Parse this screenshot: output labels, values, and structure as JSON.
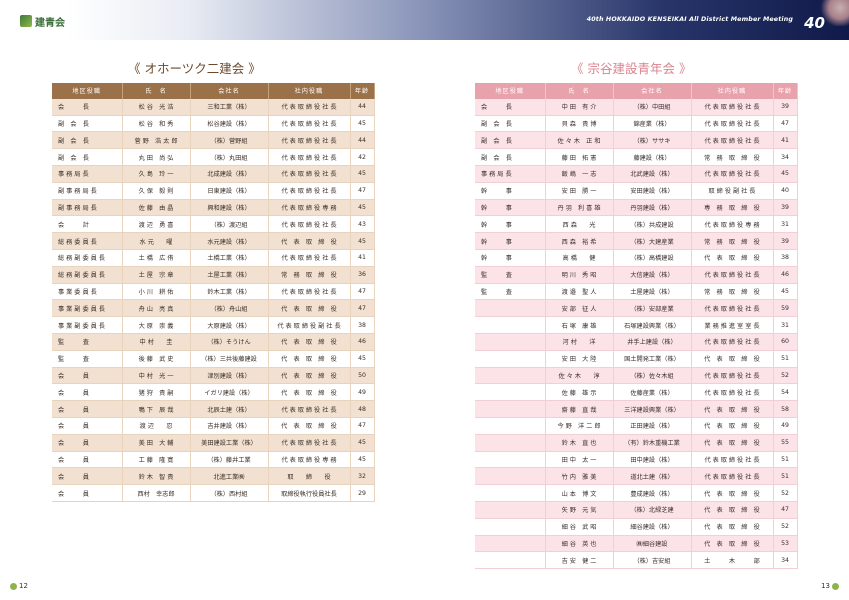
{
  "header": {
    "logo_text": "建青会",
    "meeting_title": "40th HOKKAIDO KENSEIKAI All District Member Meeting",
    "badge": "40"
  },
  "columns": [
    "地区役職",
    "氏　名",
    "会社名",
    "社内役職",
    "年齢"
  ],
  "left": {
    "title": "《 オホーツク二建会 》",
    "rows": [
      [
        "会　　　長",
        "松 谷　光 浩",
        "三和工業（株）",
        "代 表 取 締 役 社 長",
        "44"
      ],
      [
        "副　会　長",
        "松 谷　和 秀",
        "松谷建設（株）",
        "代 表 取 締 役 社 長",
        "45"
      ],
      [
        "副　会　長",
        "菅 野　浩 太 郎",
        "（株）菅野組",
        "代 表 取 締 役 社 長",
        "44"
      ],
      [
        "副　会　長",
        "丸 田　尚 弘",
        "（株）丸田組",
        "代 表 取 締 役 社 長",
        "42"
      ],
      [
        "事 務 局 長",
        "久 島　玲 一",
        "北成建設（株）",
        "代 表 取 締 役 社 長",
        "45"
      ],
      [
        "副 事 務 局 長",
        "久 保　毅 則",
        "日東建設（株）",
        "代 表 取 締 役 社 長",
        "47"
      ],
      [
        "副 事 務 局 長",
        "佐 藤　由 晶",
        "興和建設（株）",
        "代 表 取 締 役 専 務",
        "45"
      ],
      [
        "会　　　計",
        "渡 辺　勇 喜",
        "（株）渡辺組",
        "代 表 取 締 役 社 長",
        "43"
      ],
      [
        "総 務 委 員 長",
        "水 元　　曜",
        "水元建設（株）",
        "代　表　取　締　役",
        "45"
      ],
      [
        "総 務 副 委 員 長",
        "土 橋　広 侑",
        "土橋工業（株）",
        "代 表 取 締 役 社 長",
        "41"
      ],
      [
        "総 務 副 委 員 長",
        "土 屋　宗 章",
        "土屋工業（株）",
        "常　務　取　締　役",
        "36"
      ],
      [
        "事 業 委 員 長",
        "小 川　耕 佑",
        "鈴木工業（株）",
        "代 表 取 締 役 社 長",
        "47"
      ],
      [
        "事 業 副 委 員 長",
        "舟 山　亮 真",
        "（株）舟山組",
        "代　表　取　締　役",
        "47"
      ],
      [
        "事 業 副 委 員 長",
        "大 原　崇 義",
        "大原建設（株）",
        "代 表 取 締 役 副 社 長",
        "38"
      ],
      [
        "監　　　査",
        "中 村　　圭",
        "（株）そうけん",
        "代　表　取　締　役",
        "46"
      ],
      [
        "監　　　査",
        "後 藤　武 史",
        "（株）三共後藤建設",
        "代　表　取　締　役",
        "45"
      ],
      [
        "会　　　員",
        "中 村　光 一",
        "津別建設（株）",
        "代　表　取　締　役",
        "50"
      ],
      [
        "会　　　員",
        "猪 狩　貴 嗣",
        "イガリ建設（株）",
        "代　表　取　締　役",
        "49"
      ],
      [
        "会　　　員",
        "鴨 下　辰 哉",
        "北辰土建（株）",
        "代 表 取 締 役 社 長",
        "48"
      ],
      [
        "会　　　員",
        "渡 辺　　忍",
        "吉井建設（株）",
        "代　表　取　締　役",
        "47"
      ],
      [
        "会　　　員",
        "美 田　大 輔",
        "美田建設工業（株）",
        "代 表 取 締 役 社 長",
        "45"
      ],
      [
        "会　　　員",
        "工 藤　隆 寛",
        "（株）藤井工業",
        "代 表 取 締 役 専 務",
        "45"
      ],
      [
        "会　　　員",
        "鈴 木　智 貴",
        "北進工業㈱",
        "取　　締　　役",
        "32"
      ],
      [
        "会　　　員",
        "西村　幸志郎",
        "（株）西村組",
        "取締役執行役員社長",
        "29"
      ]
    ]
  },
  "right": {
    "title": "《 宗谷建設青年会 》",
    "rows": [
      [
        "会　　　長",
        "中 田　有 介",
        "（株）中田組",
        "代 表 取 締 役 社 長",
        "39"
      ],
      [
        "副　会　長",
        "貝 森　貴 博",
        "錦産業（株）",
        "代 表 取 締 役 社 長",
        "47"
      ],
      [
        "副　会　長",
        "佐 々 木　正 和",
        "（株）ササキ",
        "代 表 取 締 役 社 長",
        "41"
      ],
      [
        "副　会　長",
        "藤 田　拓 憲",
        "藤建設（株）",
        "常　務　取　締　役",
        "34"
      ],
      [
        "事 務 局 長",
        "飯 嶋　一 志",
        "北武建設（株）",
        "代 表 取 締 役 社 長",
        "45"
      ],
      [
        "幹　　　事",
        "安 田　勝 一",
        "安田建設（株）",
        "取 締 役 副 社 長",
        "40"
      ],
      [
        "幹　　　事",
        "丹 羽　利 喜 雄",
        "丹羽建設（株）",
        "専　務　取　締　役",
        "39"
      ],
      [
        "幹　　　事",
        "西 森　　光",
        "（株）共成建設",
        "代 表 取 締 役 専 務",
        "31"
      ],
      [
        "幹　　　事",
        "西 森　裕 希",
        "（株）大建産業",
        "常　務　取　締　役",
        "39"
      ],
      [
        "幹　　　事",
        "高 橋　　健",
        "（株）高橋建設",
        "代　表　取　締　役",
        "38"
      ],
      [
        "監　　　査",
        "明 川　秀 昭",
        "大信建設（株）",
        "代 表 取 締 役 社 長",
        "46"
      ],
      [
        "監　　　査",
        "渡 邉　聖 人",
        "土屋建設（株）",
        "常　務　取　締　役",
        "45"
      ],
      [
        "",
        "安 部　征 人",
        "（株）安部産業",
        "代 表 取 締 役 社 長",
        "59"
      ],
      [
        "",
        "石 塚　康 雄",
        "石塚建設興業（株）",
        "業 務 推 進 室 室 長",
        "31"
      ],
      [
        "",
        "河 村　　洋",
        "井手上建設（株）",
        "代 表 取 締 役 社 長",
        "60"
      ],
      [
        "",
        "安 田　大 陸",
        "国土開発工業（株）",
        "代　表　取　締　役",
        "51"
      ],
      [
        "",
        "佐 々 木　　淳",
        "（株）佐々木組",
        "代 表 取 締 役 社 長",
        "52"
      ],
      [
        "",
        "佐 藤　雄 示",
        "佐藤産業（株）",
        "代 表 取 締 役 社 長",
        "54"
      ],
      [
        "",
        "齋 藤　直 哉",
        "三洋建設興業（株）",
        "代　表　取　締　役",
        "58"
      ],
      [
        "",
        "今 野　洋 二 郎",
        "正田建設（株）",
        "代　表　取　締　役",
        "49"
      ],
      [
        "",
        "鈴 木　直 也",
        "（有）鈴木重機工業",
        "代　表　取　締　役",
        "55"
      ],
      [
        "",
        "田 中　太 一",
        "田中建設（株）",
        "代 表 取 締 役 社 長",
        "51"
      ],
      [
        "",
        "竹 内　雅 美",
        "道北土建（株）",
        "代 表 取 締 役 社 長",
        "51"
      ],
      [
        "",
        "山 本　博 文",
        "豊成建設（株）",
        "代　表　取　締　役",
        "52"
      ],
      [
        "",
        "矢 野　元 気",
        "（株）北緑芝建",
        "代　表　取　締　役",
        "47"
      ],
      [
        "",
        "細 谷　武 昭",
        "細谷建設（株）",
        "代　表　取　締　役",
        "52"
      ],
      [
        "",
        "細 谷　英 也",
        "㈱細谷建設",
        "代　表　取　締　役",
        "53"
      ],
      [
        "",
        "吉 安　健 二",
        "（株）吉安組",
        "土　　　木　　　部",
        "34"
      ]
    ]
  },
  "pages": {
    "left": "12",
    "right": "13"
  },
  "colors": {
    "left_header": "#9a7148",
    "right_header": "#e8a2ab",
    "left_title": "#6b4a2c",
    "right_title": "#d9848f"
  }
}
